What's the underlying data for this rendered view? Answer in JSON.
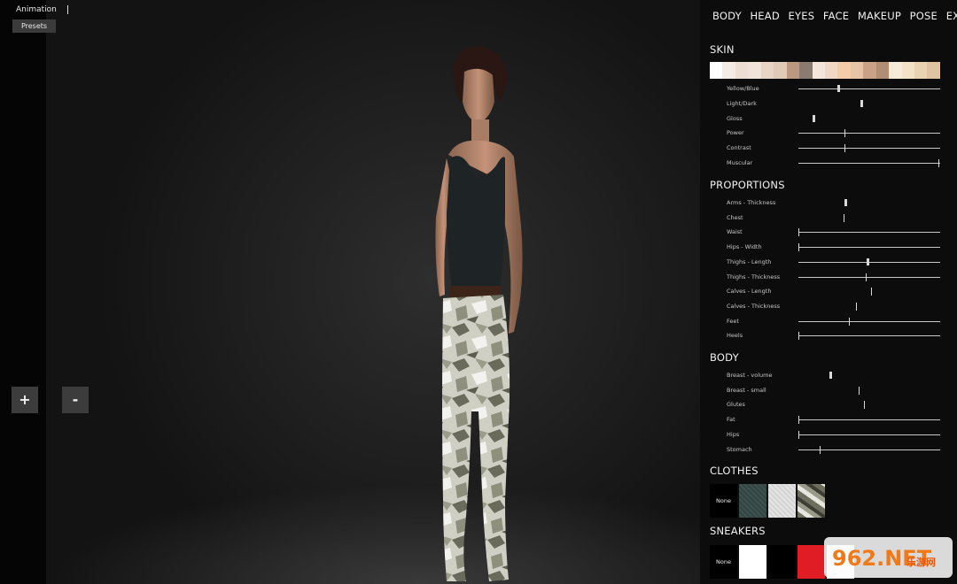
{
  "top_menu": {
    "animation_label": "Animation",
    "presets_label": "Presets"
  },
  "zoom": {
    "plus": "+",
    "minus": "-"
  },
  "tabs": [
    "BODY",
    "HEAD",
    "EYES",
    "FACE",
    "MAKEUP",
    "POSE",
    "EXTRA"
  ],
  "skin": {
    "title": "SKIN",
    "palette": [
      "#ffffff",
      "#f4ece4",
      "#ecdfd2",
      "#f0e3d8",
      "#e9d5c5",
      "#e2cab8",
      "#b99a80",
      "#8a7a70",
      "#f3e6dc",
      "#efd8c6",
      "#f4cda8",
      "#e8c4a6",
      "#c9a184",
      "#b08d73",
      "#f6ead8",
      "#f3e2c8",
      "#ead3b2",
      "#e0c4a2"
    ],
    "sliders": [
      {
        "label": "Yellow/Blue",
        "type": "knob",
        "value": 0.28
      },
      {
        "label": "Light/Dark",
        "type": "knob-only",
        "value": 0.44
      },
      {
        "label": "Gloss",
        "type": "knob-only",
        "value": 0.1
      },
      {
        "label": "Power",
        "type": "tick",
        "value": 0.33
      },
      {
        "label": "Contrast",
        "type": "tick",
        "value": 0.33
      },
      {
        "label": "Muscular",
        "type": "tick",
        "value": 1.0
      }
    ]
  },
  "proportions": {
    "title": "PROPORTIONS",
    "sliders": [
      {
        "label": "Arms - Thickness",
        "type": "knob-only",
        "value": 0.33
      },
      {
        "label": "Chest",
        "type": "tick-only",
        "value": 0.32
      },
      {
        "label": "Waist",
        "type": "tick",
        "value": 0.0
      },
      {
        "label": "Hips - Width",
        "type": "tick",
        "value": 0.0
      },
      {
        "label": "Thighs - Length",
        "type": "knob",
        "value": 0.49
      },
      {
        "label": "Thighs - Thickness",
        "type": "tick",
        "value": 0.48
      },
      {
        "label": "Calves - Length",
        "type": "tick-only",
        "value": 0.52
      },
      {
        "label": "Calves - Thickness",
        "type": "tick-only",
        "value": 0.41
      },
      {
        "label": "Feet",
        "type": "tick",
        "value": 0.36
      },
      {
        "label": "Heels",
        "type": "tick",
        "value": 0.0
      }
    ]
  },
  "body": {
    "title": "BODY",
    "sliders": [
      {
        "label": "Breast - volume",
        "type": "knob-only",
        "value": 0.22
      },
      {
        "label": "Breast - small",
        "type": "tick-only",
        "value": 0.43
      },
      {
        "label": "Glutes",
        "type": "tick-only",
        "value": 0.47
      },
      {
        "label": "Fat",
        "type": "tick",
        "value": 0.0
      },
      {
        "label": "Hips",
        "type": "tick",
        "value": 0.0
      },
      {
        "label": "Stomach",
        "type": "tick",
        "value": 0.15
      }
    ]
  },
  "clothes": {
    "title": "CLOTHES",
    "swatches": [
      {
        "name": "none",
        "label": "None",
        "color": "#000000"
      },
      {
        "name": "dark-teal",
        "label": "",
        "color": "#3a4a48"
      },
      {
        "name": "light-grey",
        "label": "",
        "color": "#d9d9d9"
      },
      {
        "name": "camo",
        "label": "",
        "color": "#7f7f6c"
      }
    ]
  },
  "sneakers": {
    "title": "SNEAKERS",
    "swatches": [
      {
        "name": "none",
        "label": "None",
        "color": "#000000"
      },
      {
        "name": "white",
        "label": "",
        "color": "#ffffff"
      },
      {
        "name": "black",
        "label": "",
        "color": "#000000"
      },
      {
        "name": "red",
        "label": "",
        "color": "#e01c24"
      },
      {
        "name": "light",
        "label": "",
        "color": "#e8e8e8"
      }
    ]
  },
  "watermark": {
    "text": "962.NET",
    "subtext": "乐游网"
  }
}
